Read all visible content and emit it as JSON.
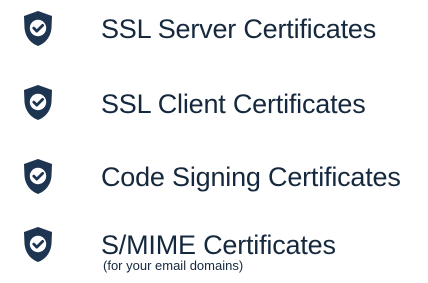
{
  "certificates": {
    "items": [
      {
        "label": "SSL Server Certificates",
        "note": "",
        "icon": "shield-check-icon"
      },
      {
        "label": "SSL Client Certificates",
        "note": "",
        "icon": "shield-check-icon"
      },
      {
        "label": "Code Signing Certificates",
        "note": "",
        "icon": "shield-check-icon"
      },
      {
        "label": "S/MIME Certificates",
        "note": "(for your email domains)",
        "icon": "shield-check-icon"
      }
    ]
  },
  "colors": {
    "shield_fill": "#1e3552",
    "check_circle": "#ffffff",
    "text": "#15283d"
  }
}
